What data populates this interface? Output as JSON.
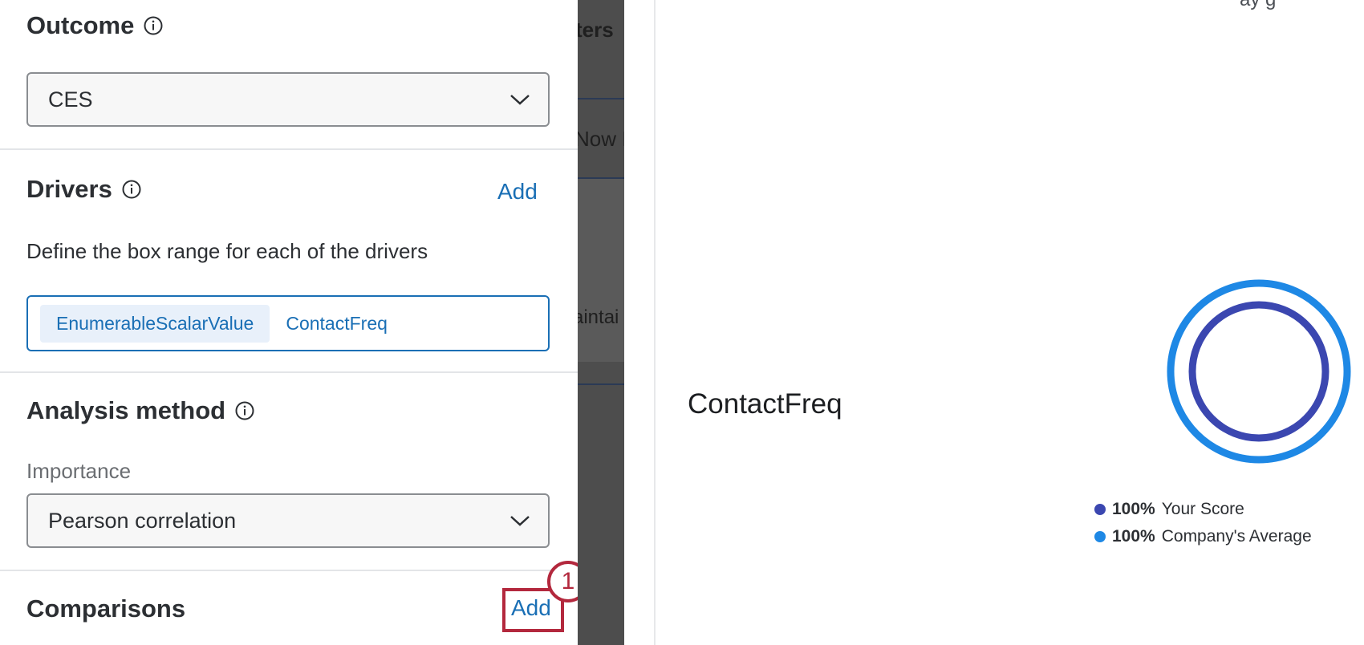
{
  "outcome": {
    "title": "Outcome",
    "selected": "CES"
  },
  "drivers": {
    "title": "Drivers",
    "add_label": "Add",
    "description": "Define the box range for each of the drivers",
    "chips": [
      "EnumerableScalarValue",
      "ContactFreq"
    ]
  },
  "analysis": {
    "title": "Analysis method",
    "importance_label": "Importance",
    "selected": "Pearson correlation"
  },
  "comparisons": {
    "title": "Comparisons",
    "add_label": "Add"
  },
  "annotation": {
    "step": "1",
    "color": "#b3283d"
  },
  "background": {
    "fragments": [
      "ters",
      "Now I",
      "aintai"
    ],
    "top_cut_text": "ay g"
  },
  "widget": {
    "driver_name": "ContactFreq",
    "your_score": {
      "value": "100%",
      "label": "Your Score",
      "color": "#3b47b0"
    },
    "company_avg": {
      "value": "100%",
      "label": "Company's Average",
      "color": "#1e88e5"
    }
  },
  "icons": [
    "info-icon",
    "chevron-down-icon"
  ]
}
